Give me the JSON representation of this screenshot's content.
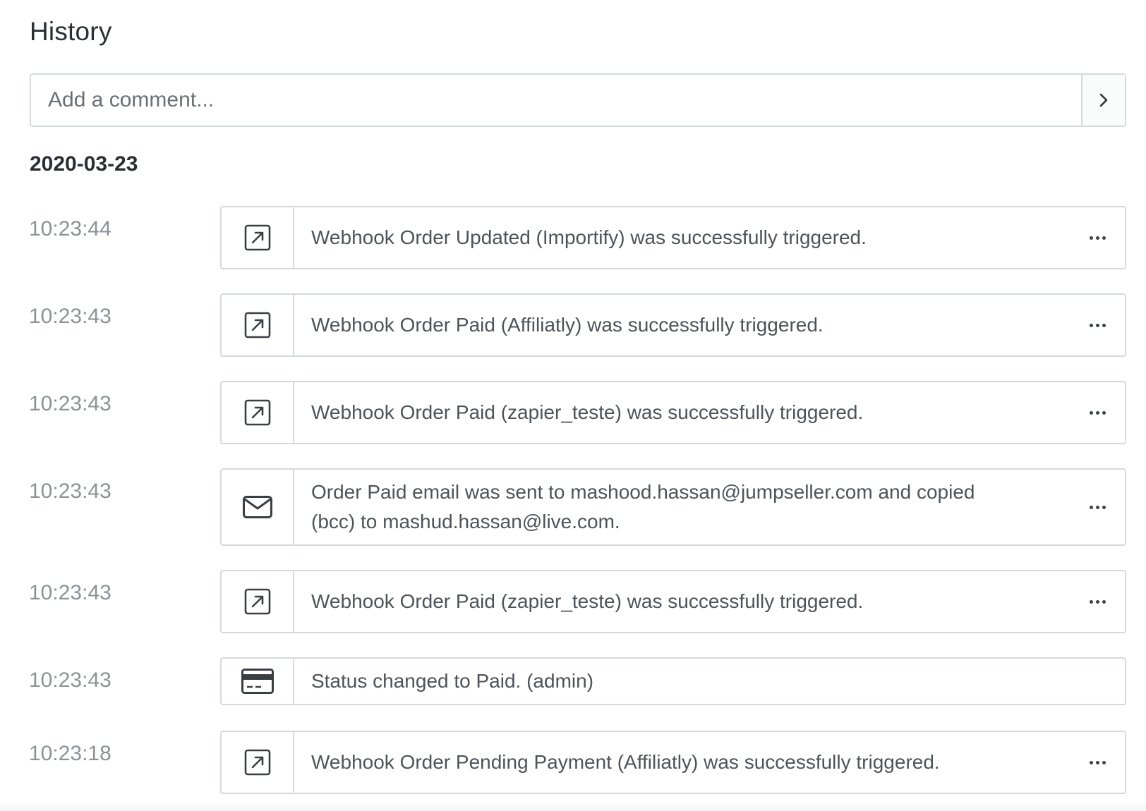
{
  "history": {
    "title": "History",
    "comment_placeholder": "Add a comment...",
    "submit_icon": "chevron-right-icon"
  },
  "groups": [
    {
      "date": "2020-03-23",
      "events": [
        {
          "time": "10:23:44",
          "icon": "external-link-icon",
          "text": "Webhook Order Updated (Importify) was successfully triggered.",
          "has_menu": true
        },
        {
          "time": "10:23:43",
          "icon": "external-link-icon",
          "text": "Webhook Order Paid (Affiliatly) was successfully triggered.",
          "has_menu": true
        },
        {
          "time": "10:23:43",
          "icon": "external-link-icon",
          "text": "Webhook Order Paid (zapier_teste) was successfully triggered.",
          "has_menu": true
        },
        {
          "time": "10:23:43",
          "icon": "envelope-icon",
          "text": "Order Paid email was sent to mashood.hassan@jumpseller.com and copied (bcc) to mashud.hassan@live.com.",
          "has_menu": true
        },
        {
          "time": "10:23:43",
          "icon": "external-link-icon",
          "text": "Webhook Order Paid (zapier_teste) was successfully triggered.",
          "has_menu": true
        },
        {
          "time": "10:23:43",
          "icon": "credit-card-icon",
          "text": "Status changed to Paid. (admin)",
          "has_menu": false
        },
        {
          "time": "10:23:18",
          "icon": "external-link-icon",
          "text": "Webhook Order Pending Payment (Affiliatly) was successfully triggered.",
          "has_menu": true
        }
      ]
    }
  ]
}
